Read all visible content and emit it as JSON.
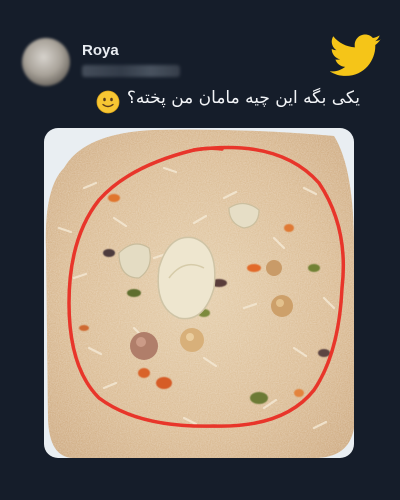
{
  "tweet": {
    "author_name": "Roya",
    "text": "یکی بگه این چیه مامان من پخته؟",
    "emoji": "slightly-smiling-face",
    "media": {
      "description_icon": "rice-dish-photo",
      "annotation_color": "#e8352a"
    }
  },
  "brand": {
    "logo": "twitter-bird-icon",
    "logo_color": "#f5c518"
  },
  "colors": {
    "background": "#151d2a",
    "text": "#f2f4f7"
  }
}
